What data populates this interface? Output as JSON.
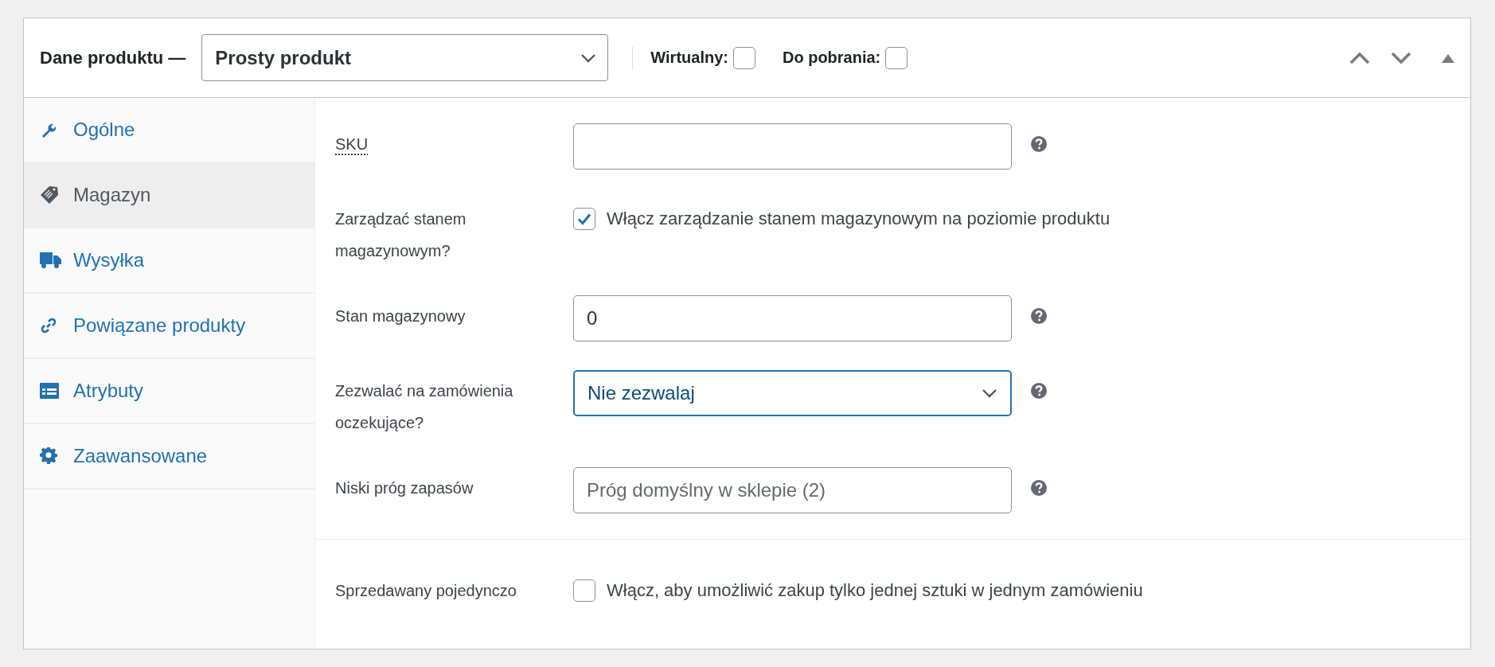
{
  "header": {
    "title": "Dane produktu —",
    "product_type": "Prosty produkt",
    "options": [
      {
        "label": "Wirtualny:",
        "checked": false
      },
      {
        "label": "Do pobrania:",
        "checked": false
      }
    ]
  },
  "tabs": [
    {
      "label": "Ogólne",
      "kind": "wrench",
      "selected": false
    },
    {
      "label": "Magazyn",
      "kind": "tag",
      "selected": true
    },
    {
      "label": "Wysyłka",
      "kind": "truck",
      "selected": false
    },
    {
      "label": "Powiązane produkty",
      "kind": "link",
      "selected": false
    },
    {
      "label": "Atrybuty",
      "kind": "list",
      "selected": false
    },
    {
      "label": "Zaawansowane",
      "kind": "gear",
      "selected": false
    }
  ],
  "sections": [
    {
      "fields": [
        {
          "kind": "text",
          "label": "SKU",
          "abbreviation": true,
          "help": true
        },
        {
          "kind": "checkbox",
          "label": "Zarządzać stanem magazynowym?",
          "abbreviation": false,
          "checked": true,
          "text": "Włącz zarządzanie stanem magazynowym na poziomie produktu",
          "help": false
        },
        {
          "kind": "text",
          "label": "Stan magazynowy",
          "abbreviation": false,
          "value": "0",
          "help": true
        },
        {
          "kind": "select",
          "label": "Zezwalać na zamówienia oczekujące?",
          "abbreviation": false,
          "value": "Nie zezwalaj",
          "focused": true,
          "help": true
        },
        {
          "kind": "text",
          "label": "Niski próg zapasów",
          "abbreviation": false,
          "placeholder": "Próg domyślny w sklepie (2)",
          "help": true
        }
      ]
    },
    {
      "fields": [
        {
          "kind": "checkbox",
          "label": "Sprzedawany pojedynczo",
          "abbreviation": false,
          "checked": false,
          "text": "Włącz, aby umożliwić zakup tylko jednej sztuki w jednym zamówieniu",
          "help": false
        }
      ]
    }
  ]
}
